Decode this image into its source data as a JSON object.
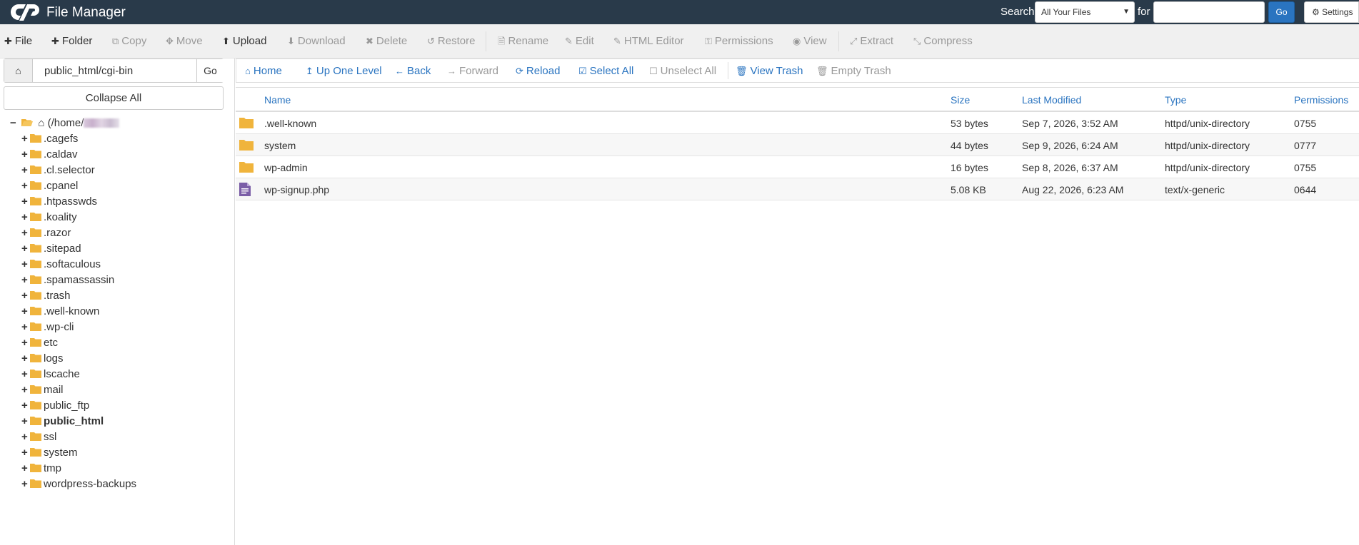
{
  "header": {
    "app_title": "File Manager",
    "search_label": "Search",
    "search_scope": "All Your Files",
    "for_label": "for",
    "search_value": "",
    "go_label": "Go",
    "settings_label": "Settings"
  },
  "toolbar": {
    "file": "File",
    "folder": "Folder",
    "copy": "Copy",
    "move": "Move",
    "upload": "Upload",
    "download": "Download",
    "delete": "Delete",
    "restore": "Restore",
    "rename": "Rename",
    "edit": "Edit",
    "html_editor": "HTML Editor",
    "permissions": "Permissions",
    "view": "View",
    "extract": "Extract",
    "compress": "Compress"
  },
  "path_bar": {
    "path": "public_html/cgi-bin",
    "go_label": "Go"
  },
  "collapse_all": "Collapse All",
  "tree": {
    "root_label": "(/home/",
    "items": [
      ".cagefs",
      ".caldav",
      ".cl.selector",
      ".cpanel",
      ".htpasswds",
      ".koality",
      ".razor",
      ".sitepad",
      ".softaculous",
      ".spamassassin",
      ".trash",
      ".well-known",
      ".wp-cli",
      "etc",
      "logs",
      "lscache",
      "mail",
      "public_ftp",
      "public_html",
      "ssl",
      "system",
      "tmp",
      "wordpress-backups"
    ]
  },
  "nav": {
    "home": "Home",
    "up_one_level": "Up One Level",
    "back": "Back",
    "forward": "Forward",
    "reload": "Reload",
    "select_all": "Select All",
    "unselect_all": "Unselect All",
    "view_trash": "View Trash",
    "empty_trash": "Empty Trash"
  },
  "table": {
    "headers": {
      "name": "Name",
      "size": "Size",
      "last_modified": "Last Modified",
      "type": "Type",
      "permissions": "Permissions"
    },
    "rows": [
      {
        "name": ".well-known",
        "size": "53 bytes",
        "modified": "Sep 7, 2026, 3:52 AM",
        "type": "httpd/unix-directory",
        "perms": "0755",
        "icon": "folder-icon"
      },
      {
        "name": "system",
        "size": "44 bytes",
        "modified": "Sep 9, 2026, 6:24 AM",
        "type": "httpd/unix-directory",
        "perms": "0777",
        "icon": "folder-icon"
      },
      {
        "name": "wp-admin",
        "size": "16 bytes",
        "modified": "Sep 8, 2026, 6:37 AM",
        "type": "httpd/unix-directory",
        "perms": "0755",
        "icon": "folder-icon"
      },
      {
        "name": "wp-signup.php",
        "size": "5.08 KB",
        "modified": "Aug 22, 2026, 6:23 AM",
        "type": "text/x-generic",
        "perms": "0644",
        "icon": "php-file-icon"
      }
    ]
  },
  "colors": {
    "header_bg": "#293a4a",
    "link_blue": "#2a74c0",
    "folder_yellow": "#f0b43c",
    "php_purple": "#7b5ea7"
  }
}
